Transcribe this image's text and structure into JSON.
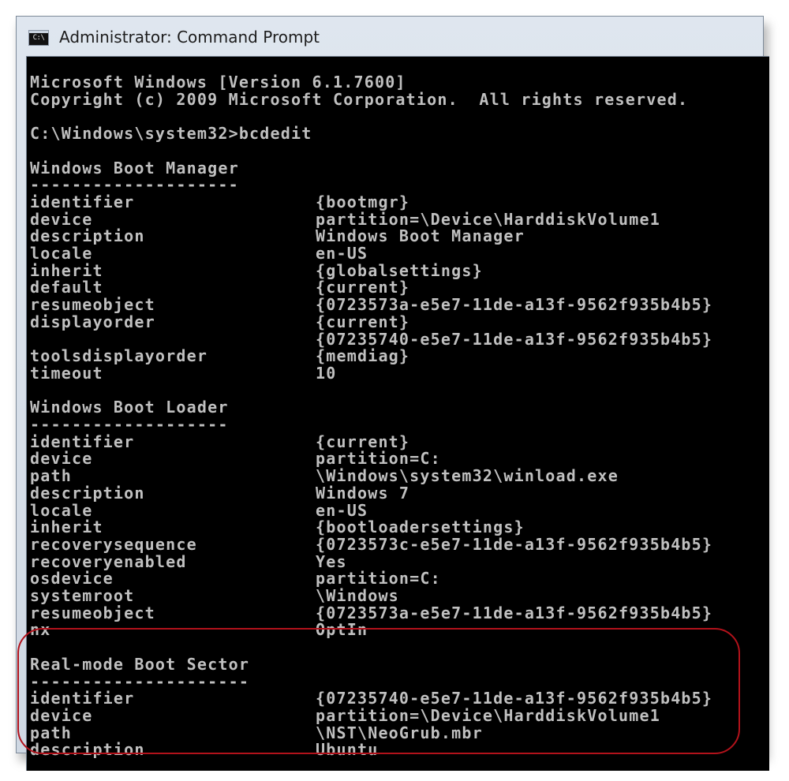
{
  "window": {
    "title": "Administrator: Command Prompt",
    "icon": "cmd-icon",
    "icon_label": "C:\\"
  },
  "console": {
    "lines": [
      {
        "key": "Microsoft Windows [Version 6.1.7600]"
      },
      {
        "key": "Copyright (c) 2009 Microsoft Corporation.  All rights reserved."
      },
      {
        "key": ""
      },
      {
        "key": "C:\\Windows\\system32>bcdedit"
      },
      {
        "key": ""
      },
      {
        "key": "Windows Boot Manager"
      },
      {
        "key": "--------------------"
      },
      {
        "key": "identifier",
        "value": "{bootmgr}"
      },
      {
        "key": "device",
        "value": "partition=\\Device\\HarddiskVolume1"
      },
      {
        "key": "description",
        "value": "Windows Boot Manager"
      },
      {
        "key": "locale",
        "value": "en-US"
      },
      {
        "key": "inherit",
        "value": "{globalsettings}"
      },
      {
        "key": "default",
        "value": "{current}"
      },
      {
        "key": "resumeobject",
        "value": "{0723573a-e5e7-11de-a13f-9562f935b4b5}"
      },
      {
        "key": "displayorder",
        "value": "{current}"
      },
      {
        "key": "",
        "value": "{07235740-e5e7-11de-a13f-9562f935b4b5}"
      },
      {
        "key": "toolsdisplayorder",
        "value": "{memdiag}"
      },
      {
        "key": "timeout",
        "value": "10"
      },
      {
        "key": ""
      },
      {
        "key": "Windows Boot Loader"
      },
      {
        "key": "-------------------"
      },
      {
        "key": "identifier",
        "value": "{current}"
      },
      {
        "key": "device",
        "value": "partition=C:"
      },
      {
        "key": "path",
        "value": "\\Windows\\system32\\winload.exe"
      },
      {
        "key": "description",
        "value": "Windows 7"
      },
      {
        "key": "locale",
        "value": "en-US"
      },
      {
        "key": "inherit",
        "value": "{bootloadersettings}"
      },
      {
        "key": "recoverysequence",
        "value": "{0723573c-e5e7-11de-a13f-9562f935b4b5}"
      },
      {
        "key": "recoveryenabled",
        "value": "Yes"
      },
      {
        "key": "osdevice",
        "value": "partition=C:"
      },
      {
        "key": "systemroot",
        "value": "\\Windows"
      },
      {
        "key": "resumeobject",
        "value": "{0723573a-e5e7-11de-a13f-9562f935b4b5}"
      },
      {
        "key": "nx",
        "value": "OptIn"
      },
      {
        "key": ""
      },
      {
        "key": "Real-mode Boot Sector"
      },
      {
        "key": "---------------------"
      },
      {
        "key": "identifier",
        "value": "{07235740-e5e7-11de-a13f-9562f935b4b5}"
      },
      {
        "key": "device",
        "value": "partition=\\Device\\HarddiskVolume1"
      },
      {
        "key": "path",
        "value": "\\NST\\NeoGrub.mbr"
      },
      {
        "key": "description",
        "value": "Ubuntu"
      }
    ]
  },
  "annotation": {
    "color": "#b2121b"
  }
}
